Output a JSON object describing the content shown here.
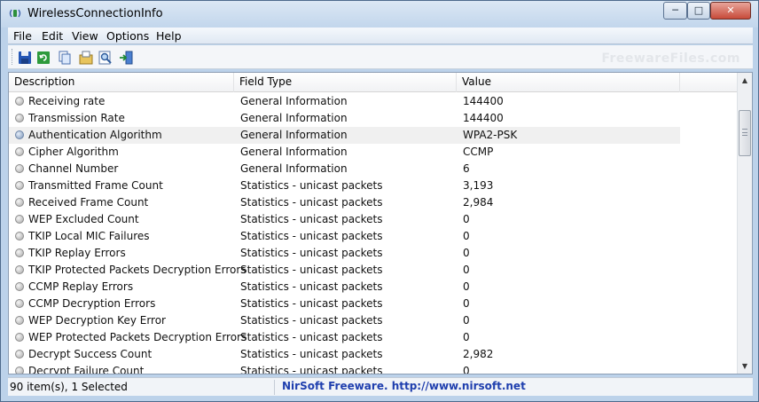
{
  "window": {
    "title": "WirelessConnectionInfo",
    "controls": {
      "minimize": "─",
      "maximize": "□",
      "close": "✕"
    }
  },
  "menu": [
    {
      "label": "File"
    },
    {
      "label": "Edit"
    },
    {
      "label": "View"
    },
    {
      "label": "Options"
    },
    {
      "label": "Help"
    }
  ],
  "toolbar": {
    "icons": [
      "save-icon",
      "refresh-icon",
      "copy-icon",
      "properties-icon",
      "find-icon",
      "exit-icon"
    ],
    "watermark": "FreewareFiles.com"
  },
  "columns": [
    "Description",
    "Field Type",
    "Value"
  ],
  "rows": [
    {
      "description": "Receiving rate",
      "field_type": "General Information",
      "value": "144400"
    },
    {
      "description": "Transmission Rate",
      "field_type": "General Information",
      "value": "144400"
    },
    {
      "description": "Authentication Algorithm",
      "field_type": "General Information",
      "value": "WPA2-PSK"
    },
    {
      "description": "Cipher Algorithm",
      "field_type": "General Information",
      "value": "CCMP"
    },
    {
      "description": "Channel Number",
      "field_type": "General Information",
      "value": "6"
    },
    {
      "description": "Transmitted Frame Count",
      "field_type": "Statistics - unicast packets",
      "value": "3,193"
    },
    {
      "description": "Received Frame Count",
      "field_type": "Statistics - unicast packets",
      "value": "2,984"
    },
    {
      "description": "WEP Excluded Count",
      "field_type": "Statistics - unicast packets",
      "value": "0"
    },
    {
      "description": "TKIP Local MIC Failures",
      "field_type": "Statistics - unicast packets",
      "value": "0"
    },
    {
      "description": "TKIP Replay Errors",
      "field_type": "Statistics - unicast packets",
      "value": "0"
    },
    {
      "description": "TKIP Protected Packets Decryption Errors",
      "field_type": "Statistics - unicast packets",
      "value": "0"
    },
    {
      "description": "CCMP Replay Errors",
      "field_type": "Statistics - unicast packets",
      "value": "0"
    },
    {
      "description": "CCMP Decryption Errors",
      "field_type": "Statistics - unicast packets",
      "value": "0"
    },
    {
      "description": "WEP Decryption Key Error",
      "field_type": "Statistics - unicast packets",
      "value": "0"
    },
    {
      "description": "WEP Protected Packets Decryption Errors",
      "field_type": "Statistics - unicast packets",
      "value": "0"
    },
    {
      "description": "Decrypt Success Count",
      "field_type": "Statistics - unicast packets",
      "value": "2,982"
    },
    {
      "description": "Decrypt Failure Count",
      "field_type": "Statistics - unicast packets",
      "value": "0"
    }
  ],
  "selected_row": "Authentication Algorithm",
  "status": {
    "count": "90 item(s), 1 Selected",
    "link": "NirSoft Freeware.  http://www.nirsoft.net"
  },
  "colors": {
    "frame": "#bcd2ea",
    "selected_row_bg": "#f0f0f0",
    "status_link": "#1f3fae"
  }
}
